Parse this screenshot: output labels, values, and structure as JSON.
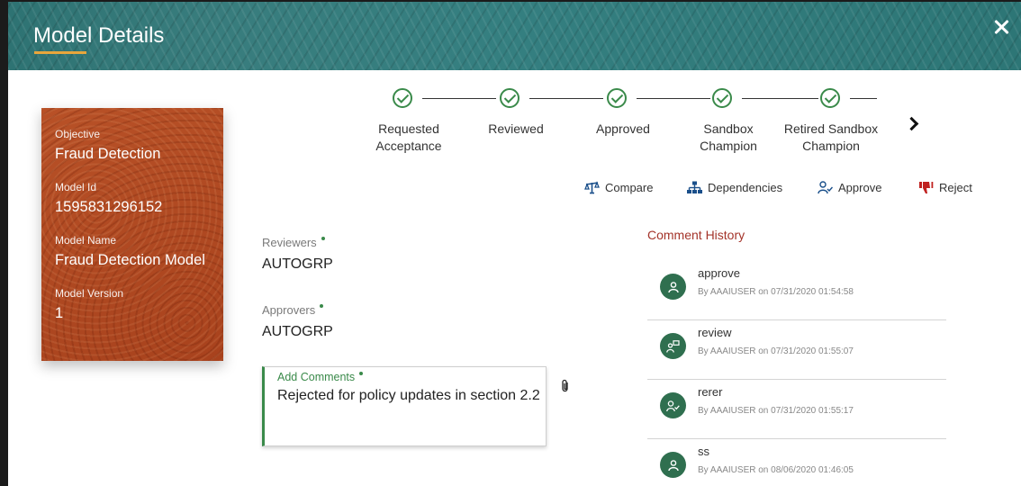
{
  "header": {
    "title": "Model Details"
  },
  "card": {
    "objective_label": "Objective",
    "objective_value": "Fraud Detection",
    "model_id_label": "Model Id",
    "model_id_value": "1595831296152",
    "model_name_label": "Model Name",
    "model_name_value": "Fraud Detection Model",
    "model_version_label": "Model Version",
    "model_version_value": "1"
  },
  "stepper": {
    "steps": [
      {
        "label": "Requested Acceptance",
        "status": "complete"
      },
      {
        "label": "Reviewed",
        "status": "complete"
      },
      {
        "label": "Approved",
        "status": "complete"
      },
      {
        "label": "Sandbox Champion",
        "status": "complete"
      },
      {
        "label": "Retired Sandbox Champion",
        "status": "complete"
      }
    ],
    "next_icon": "chevron-right-icon"
  },
  "actions": {
    "compare": "Compare",
    "dependencies": "Dependencies",
    "approve": "Approve",
    "reject": "Reject"
  },
  "fields": {
    "reviewers_label": "Reviewers",
    "reviewers_value": "AUTOGRP",
    "approvers_label": "Approvers",
    "approvers_value": "AUTOGRP",
    "comments_label": "Add Comments",
    "comments_value": "Rejected for policy updates in section 2.2"
  },
  "history": {
    "title": "Comment History",
    "items": [
      {
        "name": "approve",
        "meta": "By AAAIUSER on 07/31/2020 01:54:58",
        "icon": "user-icon"
      },
      {
        "name": "review",
        "meta": "By AAAIUSER on 07/31/2020 01:55:07",
        "icon": "user-review-icon"
      },
      {
        "name": "rerer",
        "meta": "By AAAIUSER on 07/31/2020 01:55:17",
        "icon": "user-check-icon"
      },
      {
        "name": "ss",
        "meta": "By AAAIUSER on 08/06/2020 01:46:05",
        "icon": "user-icon"
      }
    ]
  },
  "colors": {
    "header_bg": "#2f7a7a",
    "card_bg": "#b24a23",
    "accent_green": "#3a8a4a",
    "history_title": "#a4342a",
    "reject_red": "#c0211f"
  }
}
